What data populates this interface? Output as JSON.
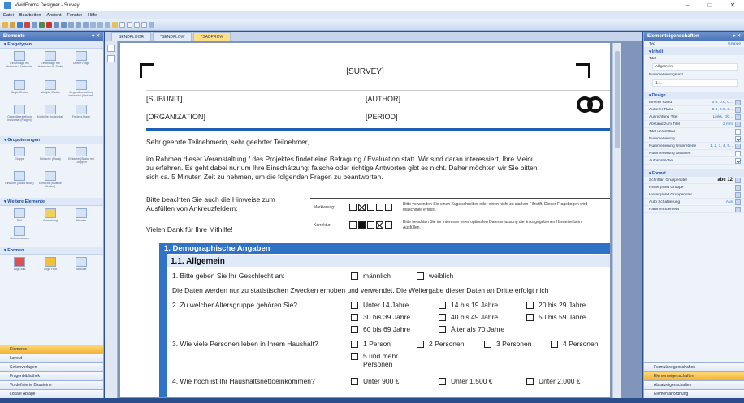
{
  "window": {
    "title": "VividForms Designer - Survey",
    "minimize": "–",
    "maximize": "□",
    "close": "✕"
  },
  "menu": [
    "Datei",
    "Bearbeiten",
    "Ansicht",
    "Fenster",
    "Hilfe"
  ],
  "left_panel": {
    "title": "Elemente",
    "sections": [
      {
        "name": "Fragetypen",
        "tools": [
          "Einzelfrage mit Antworten horizontal",
          "Einzelfrage mit Antworten für Skala",
          "Offene Frage",
          "Single Choice",
          "Multiple Choice",
          "Gegenüberstellung horizontal (Gesamt)",
          "Gegenüberstellung horizontal (Fragen)",
          "Kontrolle (horizontal)",
          "Freitext-Frage"
        ]
      },
      {
        "name": "Gruppierungen",
        "tools": [
          "Gruppe",
          "Einfache (Skala)",
          "Einfache (Skala) mit Gruppen",
          "Einfache (Skala Block)",
          "Einfache (Multiple Choice)"
        ]
      },
      {
        "name": "Weitere Elemente",
        "tools": [
          "Bild",
          "Anmerkung",
          "Hinweis",
          "Seitenumbruch"
        ]
      },
      {
        "name": "Formen",
        "tools": [
          "Logo Bild",
          "Logo Feld",
          "Barcode"
        ]
      }
    ],
    "tabs": [
      "Elemente",
      "Layout",
      "Seitenvorlagen",
      "Fragenbibliothek",
      "Vordefinierte Bausteine",
      "Lokale Ablage"
    ],
    "active_tab": "Elemente"
  },
  "doc_tabs": [
    "SENDFLOOR",
    "*SENDFLOW",
    "*SADPROW"
  ],
  "active_doc_tab": 2,
  "survey": {
    "title": "[SURVEY]",
    "subunit": "[SUBUNIT]",
    "author": "[AUTHOR]",
    "organization": "[ORGANIZATION]",
    "period": "[PERIOD]",
    "greeting": "Sehr geehrte Teilnehmerin, sehr geehrter Teilnehmer,",
    "intro_lines": [
      "im Rahmen dieser Veranstaltung / des Projektes findet eine Befragung / Evaluation statt. Wir sind daran interessiert, Ihre Meinu",
      "zu erfahren. Es geht dabei nur um Ihre Einschätzung; falsche oder richtige Antworten gibt es nicht. Daher möchten wir Sie bitten",
      "sich ca. 5 Minuten Zeit zu nehmen, um die folgenden Fragen zu beantworten."
    ],
    "hint_lines": [
      "Bitte beachten Sie auch die Hinweise zum",
      "Ausfüllen von Ankreuzfeldern:"
    ],
    "thanks": "Vielen Dank für Ihre Mithilfe!",
    "marking_label": "Markierung:",
    "marking_desc": "Bitte verwenden Sie einen Kugelschreiber oder einen nicht zu starken Filzstift. Dieser Fragebogen wird maschinell erfasst.",
    "correction_label": "Korrektur:",
    "correction_desc": "Bitte beachten Sie im Interesse einer optimalen Datenerfassung die links gegebenen Hinweise beim Ausfüllen.",
    "section_title": "1. Demographische Angaben",
    "subsection_title": "1.1. Allgemein",
    "q1": "1.  Bitte geben Sie Ihr Geschlecht an:",
    "q1_options": [
      "männlich",
      "weiblich"
    ],
    "notice": "Die Daten werden nur zu statistischen Zwecken erhoben und verwendet. Die Weitergabe dieser Daten an Dritte erfolgt nich",
    "q2": "2.  Zu welcher Altersgruppe gehören Sie?",
    "q2_options": [
      "Unter 14 Jahre",
      "14 bis 19 Jahre",
      "20 bis 29 Jahre",
      "30 bis 39 Jahre",
      "40 bis 49 Jahre",
      "50 bis 59 Jahre",
      "60 bis 69 Jahre",
      "Älter als 70 Jahre"
    ],
    "q3": "3.  Wie viele Personen leben in Ihrem Haushalt?",
    "q3_options": [
      "1 Person",
      "2 Personen",
      "3 Personen",
      "4 Personen",
      "5 und mehr Personen"
    ],
    "q4": "4.  Wie hoch ist Ihr Haushaltsnettoeinkommen?",
    "q4_options": [
      "Unter 900 €",
      "Unter 1.500 €",
      "Unter 2.000 €"
    ]
  },
  "right_panel": {
    "title": "Elementeigenschaften",
    "type_label": "Typ",
    "type_value": "Gruppe",
    "inhalt": {
      "header": "Inhalt",
      "titel_label": "Titel",
      "titel_value": "Allgemein",
      "nr_label": "Nummerierungstext",
      "nr_value": "1.1."
    },
    "design_header": "Design",
    "design_rows": [
      {
        "k": "Innerer Rand",
        "v": "0.0, 0.0, 0..."
      },
      {
        "k": "Äußerer Rand",
        "v": "0.0, 0.0, 0..."
      },
      {
        "k": "Ausrichtung Titel",
        "v": "Links, Ob..."
      },
      {
        "k": "Abstand zum Titel",
        "v": "2 mm"
      },
      {
        "k": "Titel unsichtbar",
        "v": ""
      },
      {
        "k": "Nummerierung",
        "v": ""
      },
      {
        "k": "Nummerierung Unterebene",
        "v": "1, 2, 3, 4, 5..."
      },
      {
        "k": "Nummerierung anhalten",
        "v": ""
      },
      {
        "k": "Automatische...",
        "v": ""
      }
    ],
    "format_header": "Format",
    "format_rows": [
      {
        "k": "Schriftart Gruppentitel",
        "v": "abc 12"
      },
      {
        "k": "Hintergrund Gruppe",
        "v": ""
      },
      {
        "k": "Hintergrund Gruppentitel",
        "v": ""
      },
      {
        "k": "Auto Schattierung",
        "v": "Aus"
      },
      {
        "k": "Rahmen Element",
        "v": ""
      }
    ],
    "tabs": [
      "Formulareigenschaften",
      "Elementeigenschaften",
      "Absatzeigenschaften",
      "Elementanordnung"
    ],
    "active_tab": "Elementeigenschaften"
  },
  "colors": {
    "accent": "#2f73c6",
    "highlight": "#f4b333",
    "chrome": "#2f4f8f"
  }
}
